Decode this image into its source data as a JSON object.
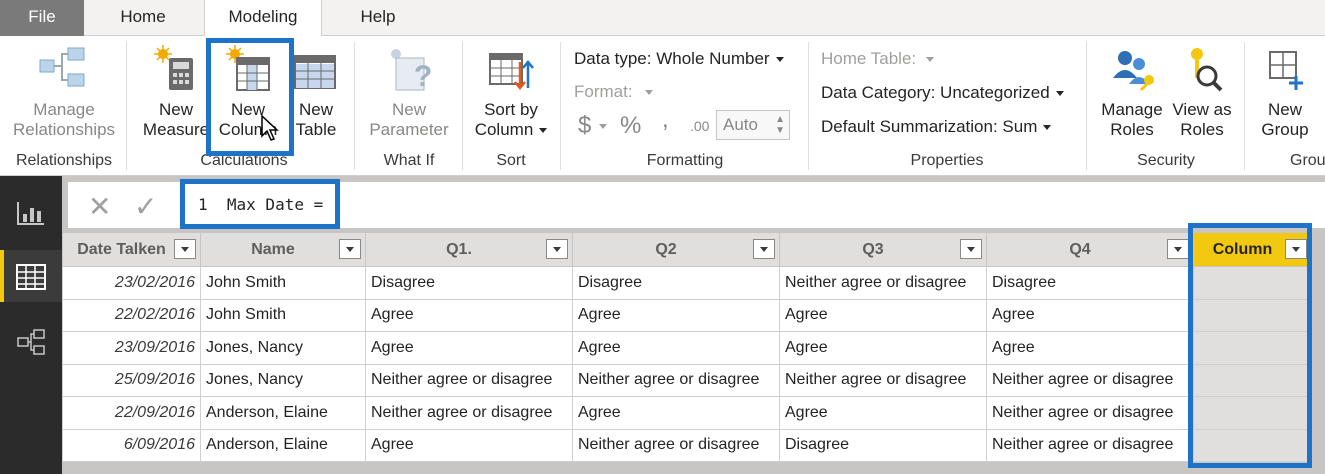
{
  "tabs": [
    "File",
    "Home",
    "Modeling",
    "Help"
  ],
  "ribbon": {
    "relationships": {
      "manage": "Manage\nRelationships",
      "group": "Relationships"
    },
    "calculations": {
      "new_measure": "New\nMeasure",
      "new_column": "New\nColumn",
      "new_table": "New\nTable",
      "group": "Calculations"
    },
    "whatif": {
      "new_parameter": "New\nParameter",
      "group": "What If"
    },
    "sort": {
      "sort_by_column": "Sort by\nColumn",
      "group": "Sort"
    },
    "formatting": {
      "data_type": "Data type: Whole Number",
      "format": "Format:",
      "currency": "$",
      "percent": "%",
      "comma": ",",
      "decimal": ".00",
      "auto": "Auto",
      "group": "Formatting"
    },
    "properties": {
      "home_table": "Home Table:",
      "data_category": "Data Category: Uncategorized",
      "default_summarization": "Default Summarization: Sum",
      "group": "Properties"
    },
    "security": {
      "manage_roles": "Manage\nRoles",
      "view_as_roles": "View as\nRoles",
      "group": "Security"
    },
    "groups": {
      "new_group": "New\nGroup",
      "group": "Grou"
    }
  },
  "formula_bar": {
    "cancel": "✕",
    "commit": "✓",
    "text": "1  Max Date ="
  },
  "table": {
    "columns": [
      "Date Talken",
      "Name",
      "Q1.",
      "Q2",
      "Q3",
      "Q4",
      "Column"
    ],
    "rows": [
      [
        "23/02/2016",
        "John Smith",
        "Disagree",
        "Disagree",
        "Neither agree or disagree",
        "Disagree",
        ""
      ],
      [
        "22/02/2016",
        "John Smith",
        "Agree",
        "Agree",
        "Agree",
        "Agree",
        ""
      ],
      [
        "23/09/2016",
        "Jones, Nancy",
        "Agree",
        "Agree",
        "Agree",
        "Agree",
        ""
      ],
      [
        "25/09/2016",
        "Jones, Nancy",
        "Neither agree or disagree",
        "Neither agree or disagree",
        "Neither agree or disagree",
        "Neither agree or disagree",
        ""
      ],
      [
        "22/09/2016",
        "Anderson, Elaine",
        "Neither agree or disagree",
        "Agree",
        "Agree",
        "Neither agree or disagree",
        ""
      ],
      [
        "6/09/2016",
        "Anderson, Elaine",
        "Agree",
        "Neither agree or disagree",
        "Disagree",
        "Neither agree or disagree",
        ""
      ]
    ]
  },
  "colors": {
    "highlight": "#1e73c8",
    "accent": "#f2c811",
    "rail": "#2b2b2b"
  }
}
